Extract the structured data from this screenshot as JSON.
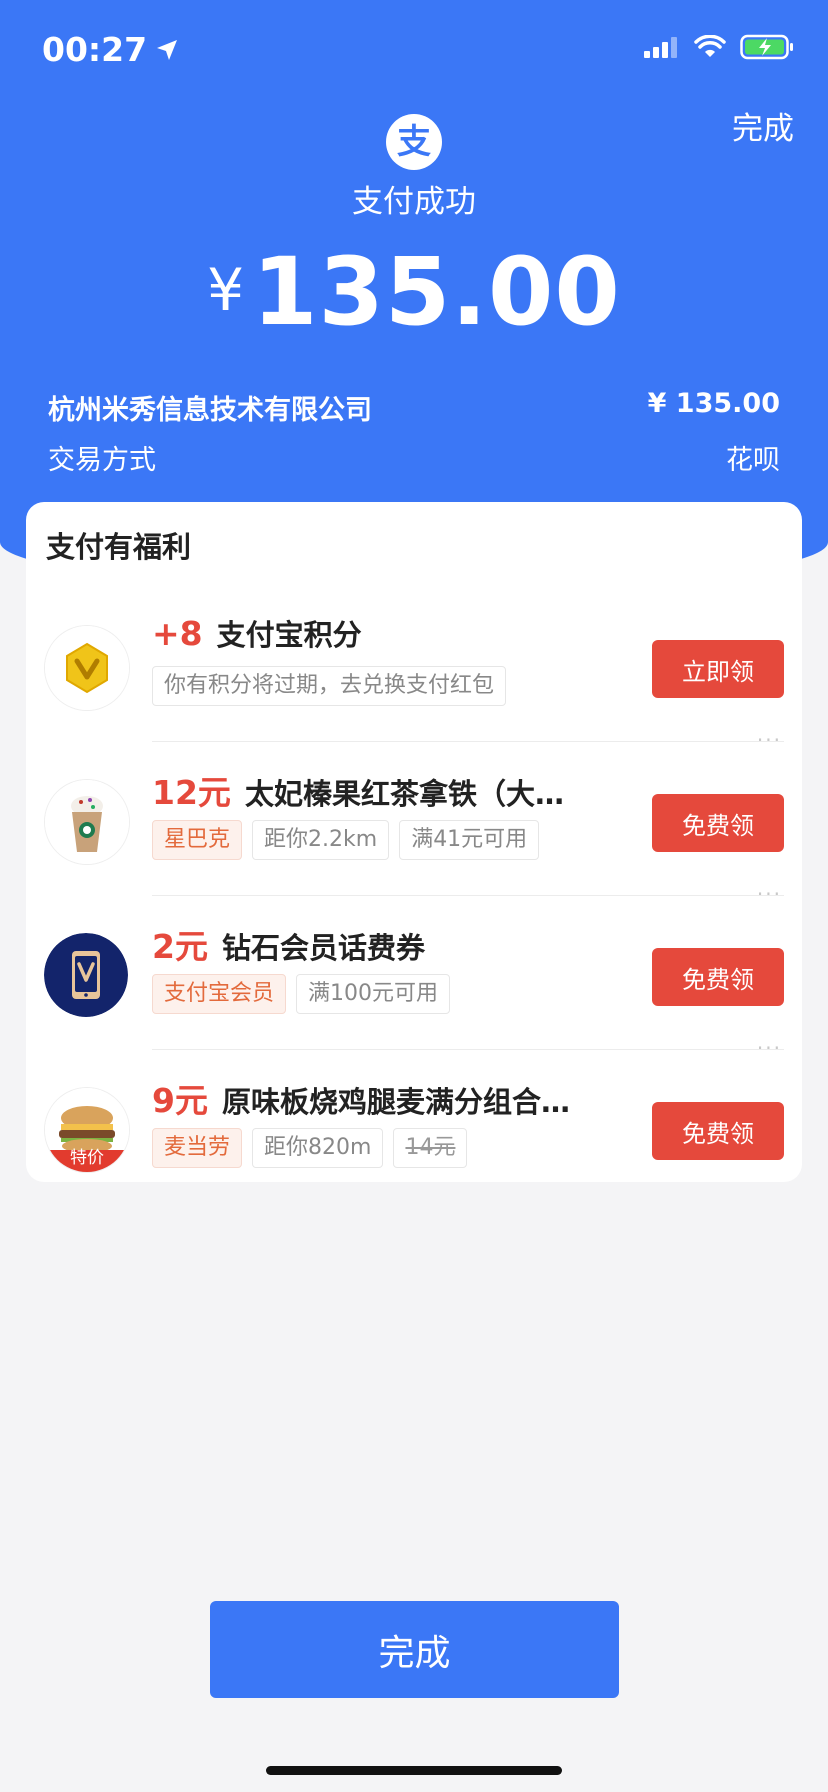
{
  "status_bar": {
    "time": "00:27"
  },
  "header": {
    "done_label": "完成",
    "brand_glyph": "支",
    "status_text": "支付成功",
    "currency": "¥",
    "amount": "135.00",
    "merchant_name": "杭州米秀信息技术有限公司",
    "merchant_amount": "¥ 135.00",
    "method_label": "交易方式",
    "method_value": "花呗"
  },
  "benefits": {
    "title": "支付有福利",
    "offers": [
      {
        "value": "+8",
        "title": "支付宝积分",
        "tags": [
          "你有积分将过期，去兑换支付红包"
        ],
        "button": "立即领",
        "icon": "gold-coin-icon"
      },
      {
        "value": "12元",
        "title": "太妃榛果红茶拿铁（大杯…",
        "tags": [
          "星巴克",
          "距你2.2km",
          "满41元可用"
        ],
        "button": "免费领",
        "icon": "starbucks-drink-image"
      },
      {
        "value": "2元",
        "title": "钻石会员话费券",
        "tags": [
          "支付宝会员",
          "满100元可用"
        ],
        "button": "免费领",
        "icon": "phone-voucher-icon"
      },
      {
        "value": "9元",
        "title": "原味板烧鸡腿麦满分组合…",
        "tags": [
          "麦当劳",
          "距你820m",
          "14元"
        ],
        "badge": "特价",
        "button": "免费领",
        "icon": "burger-image"
      }
    ]
  },
  "footer": {
    "done_label": "完成"
  },
  "colors": {
    "primary": "#3b77f6",
    "accent": "#e5493c"
  }
}
